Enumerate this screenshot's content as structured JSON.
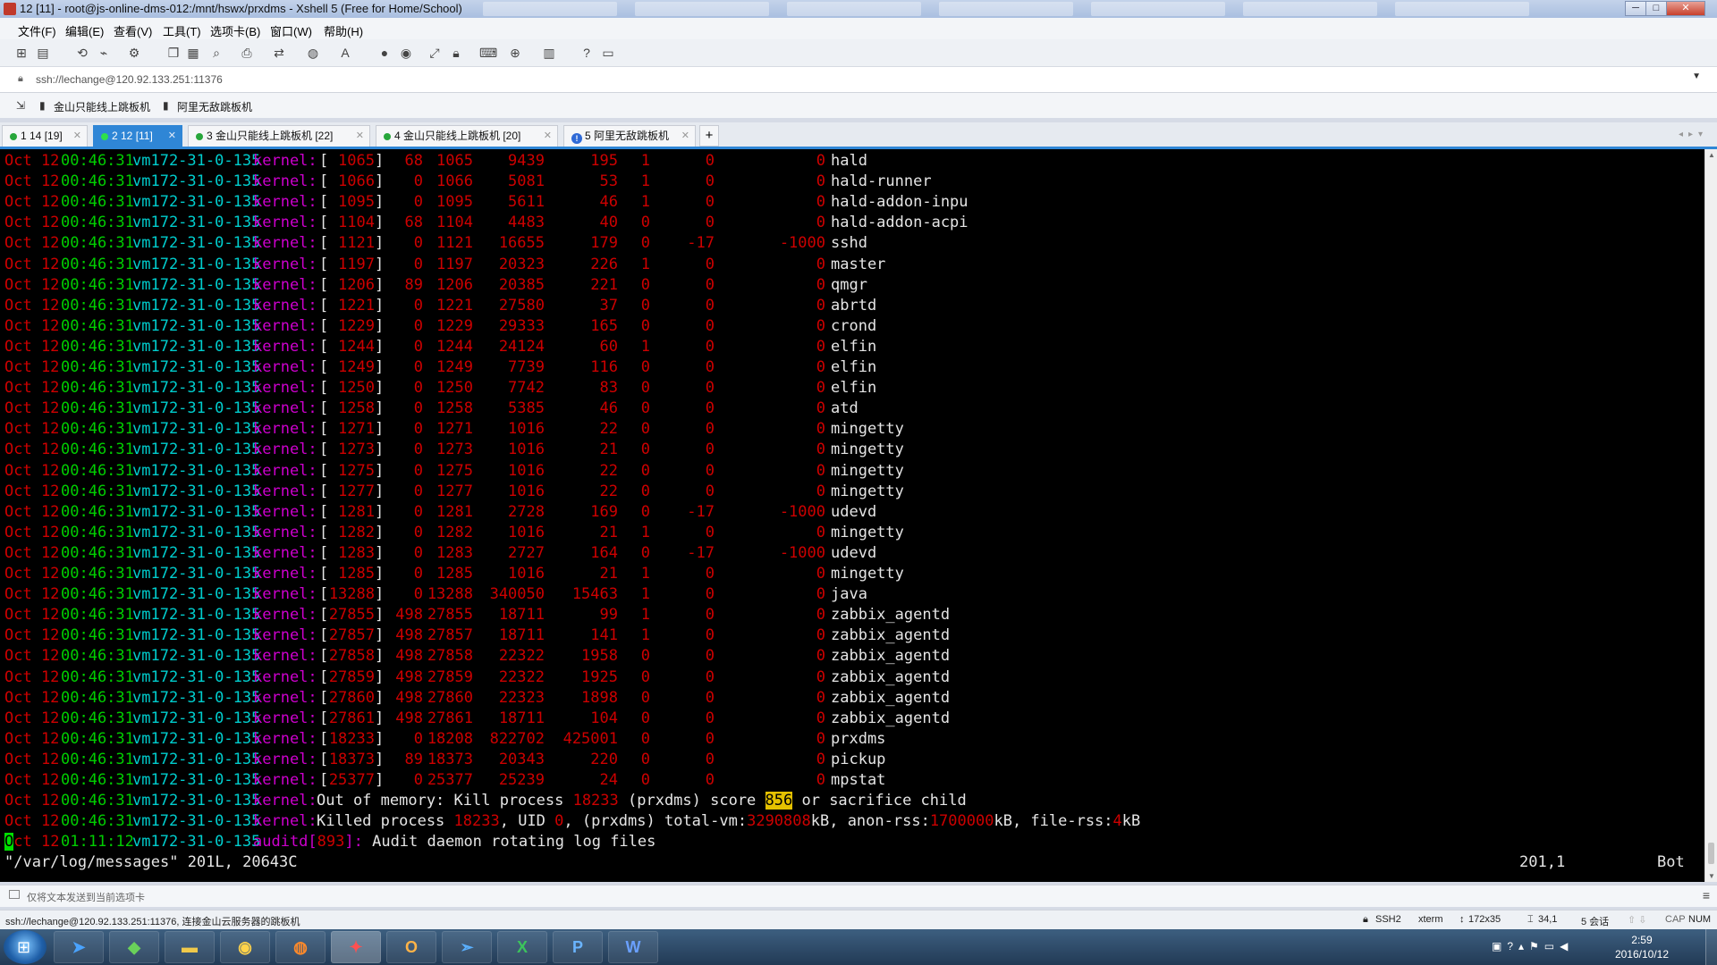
{
  "window": {
    "title": "12 [11] - root@js-online-dms-012:/mnt/hswx/prxdms - Xshell 5 (Free for Home/School)",
    "min_label": "─",
    "max_label": "□",
    "close_label": "✕"
  },
  "menu": [
    "文件(F)",
    "编辑(E)",
    "查看(V)",
    "工具(T)",
    "选项卡(B)",
    "窗口(W)",
    "帮助(H)"
  ],
  "toolbar_icons": [
    "new-session-icon",
    "open-icon",
    "reconnect-icon",
    "disconnect-icon",
    "properties-icon",
    "copy-icon",
    "paste-icon",
    "find-icon",
    "print-icon",
    "transfer-icon",
    "globe-icon",
    "font-icon",
    "xftp-icon",
    "xmanager-icon",
    "fullscreen-icon",
    "lock-icon",
    "keyboard-icon",
    "compose-icon",
    "layout-icon",
    "help-icon",
    "chat-icon"
  ],
  "address": {
    "value": "ssh://lechange@120.92.133.251:11376"
  },
  "links": [
    "金山只能线上跳板机",
    "阿里无敌跳板机"
  ],
  "tabs": [
    {
      "label": "1 14 [19]",
      "active": false,
      "status": "green"
    },
    {
      "label": "2 12 [11]",
      "active": true,
      "status": "green"
    },
    {
      "label": "3 金山只能线上跳板机 [22]",
      "active": false,
      "status": "green"
    },
    {
      "label": "4 金山只能线上跳板机 [20]",
      "active": false,
      "status": "green"
    },
    {
      "label": "5 阿里无敌跳板机",
      "active": false,
      "status": "info"
    }
  ],
  "terminal": {
    "date": "Oct 12",
    "time": "00:46:31",
    "host": "vm172-31-0-135",
    "tag": "kernel:",
    "process_rows": [
      {
        "pid": " 1065",
        "uid": "68",
        "tgid": "1065",
        "total_vm": "9439",
        "rss": "195",
        "cpu": "1",
        "oom_adj": "0",
        "oom_score_adj": "0",
        "name": "hald"
      },
      {
        "pid": " 1066",
        "uid": "0",
        "tgid": "1066",
        "total_vm": "5081",
        "rss": "53",
        "cpu": "1",
        "oom_adj": "0",
        "oom_score_adj": "0",
        "name": "hald-runner"
      },
      {
        "pid": " 1095",
        "uid": "0",
        "tgid": "1095",
        "total_vm": "5611",
        "rss": "46",
        "cpu": "1",
        "oom_adj": "0",
        "oom_score_adj": "0",
        "name": "hald-addon-inpu"
      },
      {
        "pid": " 1104",
        "uid": "68",
        "tgid": "1104",
        "total_vm": "4483",
        "rss": "40",
        "cpu": "0",
        "oom_adj": "0",
        "oom_score_adj": "0",
        "name": "hald-addon-acpi"
      },
      {
        "pid": " 1121",
        "uid": "0",
        "tgid": "1121",
        "total_vm": "16655",
        "rss": "179",
        "cpu": "0",
        "oom_adj": "-17",
        "oom_score_adj": "-1000",
        "name": "sshd"
      },
      {
        "pid": " 1197",
        "uid": "0",
        "tgid": "1197",
        "total_vm": "20323",
        "rss": "226",
        "cpu": "1",
        "oom_adj": "0",
        "oom_score_adj": "0",
        "name": "master"
      },
      {
        "pid": " 1206",
        "uid": "89",
        "tgid": "1206",
        "total_vm": "20385",
        "rss": "221",
        "cpu": "0",
        "oom_adj": "0",
        "oom_score_adj": "0",
        "name": "qmgr"
      },
      {
        "pid": " 1221",
        "uid": "0",
        "tgid": "1221",
        "total_vm": "27580",
        "rss": "37",
        "cpu": "0",
        "oom_adj": "0",
        "oom_score_adj": "0",
        "name": "abrtd"
      },
      {
        "pid": " 1229",
        "uid": "0",
        "tgid": "1229",
        "total_vm": "29333",
        "rss": "165",
        "cpu": "0",
        "oom_adj": "0",
        "oom_score_adj": "0",
        "name": "crond"
      },
      {
        "pid": " 1244",
        "uid": "0",
        "tgid": "1244",
        "total_vm": "24124",
        "rss": "60",
        "cpu": "1",
        "oom_adj": "0",
        "oom_score_adj": "0",
        "name": "elfin"
      },
      {
        "pid": " 1249",
        "uid": "0",
        "tgid": "1249",
        "total_vm": "7739",
        "rss": "116",
        "cpu": "0",
        "oom_adj": "0",
        "oom_score_adj": "0",
        "name": "elfin"
      },
      {
        "pid": " 1250",
        "uid": "0",
        "tgid": "1250",
        "total_vm": "7742",
        "rss": "83",
        "cpu": "0",
        "oom_adj": "0",
        "oom_score_adj": "0",
        "name": "elfin"
      },
      {
        "pid": " 1258",
        "uid": "0",
        "tgid": "1258",
        "total_vm": "5385",
        "rss": "46",
        "cpu": "0",
        "oom_adj": "0",
        "oom_score_adj": "0",
        "name": "atd"
      },
      {
        "pid": " 1271",
        "uid": "0",
        "tgid": "1271",
        "total_vm": "1016",
        "rss": "22",
        "cpu": "0",
        "oom_adj": "0",
        "oom_score_adj": "0",
        "name": "mingetty"
      },
      {
        "pid": " 1273",
        "uid": "0",
        "tgid": "1273",
        "total_vm": "1016",
        "rss": "21",
        "cpu": "0",
        "oom_adj": "0",
        "oom_score_adj": "0",
        "name": "mingetty"
      },
      {
        "pid": " 1275",
        "uid": "0",
        "tgid": "1275",
        "total_vm": "1016",
        "rss": "22",
        "cpu": "0",
        "oom_adj": "0",
        "oom_score_adj": "0",
        "name": "mingetty"
      },
      {
        "pid": " 1277",
        "uid": "0",
        "tgid": "1277",
        "total_vm": "1016",
        "rss": "22",
        "cpu": "0",
        "oom_adj": "0",
        "oom_score_adj": "0",
        "name": "mingetty"
      },
      {
        "pid": " 1281",
        "uid": "0",
        "tgid": "1281",
        "total_vm": "2728",
        "rss": "169",
        "cpu": "0",
        "oom_adj": "-17",
        "oom_score_adj": "-1000",
        "name": "udevd"
      },
      {
        "pid": " 1282",
        "uid": "0",
        "tgid": "1282",
        "total_vm": "1016",
        "rss": "21",
        "cpu": "1",
        "oom_adj": "0",
        "oom_score_adj": "0",
        "name": "mingetty"
      },
      {
        "pid": " 1283",
        "uid": "0",
        "tgid": "1283",
        "total_vm": "2727",
        "rss": "164",
        "cpu": "0",
        "oom_adj": "-17",
        "oom_score_adj": "-1000",
        "name": "udevd"
      },
      {
        "pid": " 1285",
        "uid": "0",
        "tgid": "1285",
        "total_vm": "1016",
        "rss": "21",
        "cpu": "1",
        "oom_adj": "0",
        "oom_score_adj": "0",
        "name": "mingetty"
      },
      {
        "pid": "13288",
        "uid": "0",
        "tgid": "13288",
        "total_vm": "340050",
        "rss": "15463",
        "cpu": "1",
        "oom_adj": "0",
        "oom_score_adj": "0",
        "name": "java"
      },
      {
        "pid": "27855",
        "uid": "498",
        "tgid": "27855",
        "total_vm": "18711",
        "rss": "99",
        "cpu": "1",
        "oom_adj": "0",
        "oom_score_adj": "0",
        "name": "zabbix_agentd"
      },
      {
        "pid": "27857",
        "uid": "498",
        "tgid": "27857",
        "total_vm": "18711",
        "rss": "141",
        "cpu": "1",
        "oom_adj": "0",
        "oom_score_adj": "0",
        "name": "zabbix_agentd"
      },
      {
        "pid": "27858",
        "uid": "498",
        "tgid": "27858",
        "total_vm": "22322",
        "rss": "1958",
        "cpu": "0",
        "oom_adj": "0",
        "oom_score_adj": "0",
        "name": "zabbix_agentd"
      },
      {
        "pid": "27859",
        "uid": "498",
        "tgid": "27859",
        "total_vm": "22322",
        "rss": "1925",
        "cpu": "0",
        "oom_adj": "0",
        "oom_score_adj": "0",
        "name": "zabbix_agentd"
      },
      {
        "pid": "27860",
        "uid": "498",
        "tgid": "27860",
        "total_vm": "22323",
        "rss": "1898",
        "cpu": "0",
        "oom_adj": "0",
        "oom_score_adj": "0",
        "name": "zabbix_agentd"
      },
      {
        "pid": "27861",
        "uid": "498",
        "tgid": "27861",
        "total_vm": "18711",
        "rss": "104",
        "cpu": "0",
        "oom_adj": "0",
        "oom_score_adj": "0",
        "name": "zabbix_agentd"
      },
      {
        "pid": "18233",
        "uid": "0",
        "tgid": "18208",
        "total_vm": "822702",
        "rss": "425001",
        "cpu": "0",
        "oom_adj": "0",
        "oom_score_adj": "0",
        "name": "prxdms"
      },
      {
        "pid": "18373",
        "uid": "89",
        "tgid": "18373",
        "total_vm": "20343",
        "rss": "220",
        "cpu": "0",
        "oom_adj": "0",
        "oom_score_adj": "0",
        "name": "pickup"
      },
      {
        "pid": "25377",
        "uid": "0",
        "tgid": "25377",
        "total_vm": "25239",
        "rss": "24",
        "cpu": "0",
        "oom_adj": "0",
        "oom_score_adj": "0",
        "name": "mpstat"
      }
    ],
    "oom_line": {
      "p1": "Out of memory: Kill process ",
      "pid": "18233",
      "p2": " (prxdms) score ",
      "score": "856",
      "p3": " or sacrifice child"
    },
    "killed_line": {
      "p1": "Killed process ",
      "pid": "18233",
      "p2": ", UID ",
      "uid": "0",
      "p3": ", (prxdms) total-vm:",
      "total_vm": "3290808",
      "p4": "kB, anon-rss:",
      "anon_rss": "1700000",
      "p5": "kB, file-rss:",
      "file_rss": "4",
      "p6": "kB"
    },
    "audit_line": {
      "cursor": "O",
      "date_rest": "ct 12",
      "time": "01:11:12",
      "host": "vm172-31-0-135",
      "tag": "auditd[",
      "pid": "893",
      "tag_end": "]:",
      "msg": " Audit daemon rotating log files"
    },
    "vim_status": {
      "file": "\"/var/log/messages\" 201L, 20643C",
      "position": "201,1",
      "scroll": "Bot"
    }
  },
  "input_bar": {
    "text": "仅将文本发送到当前选项卡"
  },
  "status_bar": {
    "connection": "ssh://lechange@120.92.133.251:11376, 连接金山云服务器的跳板机",
    "protocol": "SSH2",
    "term": "xterm",
    "size": "172x35",
    "cursor_pos": "34,1",
    "sessions": "5 会话",
    "caps": "CAP",
    "num": "NUM"
  },
  "taskbar": {
    "apps": [
      "start-icon",
      "feather-icon",
      "evernote-icon",
      "explorer-icon",
      "chrome-icon",
      "firefox-icon",
      "xshell-icon",
      "outlook-icon",
      "messenger-icon",
      "excel-icon",
      "project-icon",
      "word-icon"
    ],
    "clock_time": "2:59",
    "clock_date": "2016/10/12"
  },
  "colors": {
    "terminal_bg": "#000000",
    "red": "#cd0000",
    "green": "#00cd00",
    "cyan": "#00cdcd",
    "magenta": "#cd00cd",
    "accent": "#2f86d6"
  }
}
